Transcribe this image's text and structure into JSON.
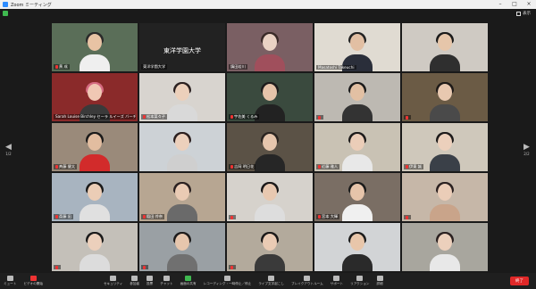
{
  "window": {
    "title": "Zoom ミーティング",
    "view_label": "表示"
  },
  "tiles": [
    {
      "name": "黄 成",
      "mic_muted": true,
      "bg": "#5a6e58",
      "skin": "#e8c3a4",
      "hair": "#2a2a2a",
      "shirt": "#efefef",
      "active": false
    },
    {
      "name": "東洋学園大学",
      "mic_muted": false,
      "bg": "#222222",
      "skin": "",
      "hair": "",
      "shirt": "",
      "active": true,
      "big_text": "東洋学園大学"
    },
    {
      "name": "鎮田若川",
      "mic_muted": false,
      "bg": "#7a5f63",
      "skin": "#ead2c4",
      "hair": "#3a2a28",
      "shirt": "#a04f5c",
      "active": false
    },
    {
      "name": "Masatoshi Takeuchi",
      "mic_muted": false,
      "bg": "#e0dbd2",
      "skin": "#e2bfa3",
      "hair": "#222222",
      "shirt": "#2a2e3a",
      "active": false
    },
    {
      "name": "",
      "mic_muted": false,
      "bg": "#cfcac3",
      "skin": "#e6c6aa",
      "hair": "#1a1a1a",
      "shirt": "#2f2f2f",
      "active": false
    },
    {
      "name": "Sarah Louise Birchley セーラ ルイーズ バーチ…",
      "mic_muted": false,
      "bg": "#8a2a2a",
      "skin": "#f0c8b4",
      "hair": "#d46a80",
      "shirt": "#3a3a3a",
      "active": false
    },
    {
      "name": "松本菜々子",
      "mic_muted": true,
      "bg": "#d8d4cf",
      "skin": "#ecd0bb",
      "hair": "#2a2020",
      "shirt": "#d9d9d9",
      "active": false
    },
    {
      "name": "宇佐美 くるみ",
      "mic_muted": true,
      "bg": "#3a4a3e",
      "skin": "#e6c4aa",
      "hair": "#1e1c1c",
      "shirt": "#222222",
      "active": false
    },
    {
      "name": "",
      "mic_muted": true,
      "bg": "#bdb9b2",
      "skin": "#e2c0a3",
      "hair": "#1a1a1a",
      "shirt": "#333333",
      "active": false
    },
    {
      "name": "",
      "mic_muted": true,
      "bg": "#6b5b45",
      "skin": "#e8c8b0",
      "hair": "#1e1a18",
      "shirt": "#4a4a4a",
      "active": false
    },
    {
      "name": "斉藤 健太",
      "mic_muted": true,
      "bg": "#9a8a7a",
      "skin": "#e2bda0",
      "hair": "#1a1a1a",
      "shirt": "#d22b2b",
      "active": false
    },
    {
      "name": "",
      "mic_muted": false,
      "bg": "#cdd2d6",
      "skin": "#ecd0bc",
      "hair": "#2a1e1e",
      "shirt": "#cfcfcf",
      "active": false
    },
    {
      "name": "吉岡 明日花",
      "mic_muted": true,
      "bg": "#5b5246",
      "skin": "#e6c6ad",
      "hair": "#2a2420",
      "shirt": "#262626",
      "active": false
    },
    {
      "name": "近藤 雅人",
      "mic_muted": true,
      "bg": "#c9c2b4",
      "skin": "#ebcdb8",
      "hair": "#1c1a1a",
      "shirt": "#e8e8e8",
      "active": false
    },
    {
      "name": "伊東 誠",
      "mic_muted": true,
      "bg": "#cfc8bb",
      "skin": "#ecd0bc",
      "hair": "#1c1a1a",
      "shirt": "#3a4048",
      "active": false
    },
    {
      "name": "斎藤 凪",
      "mic_muted": true,
      "bg": "#a8b4c0",
      "skin": "#ebcdb6",
      "hair": "#1a1a1a",
      "shirt": "#e0e0e0",
      "active": false
    },
    {
      "name": "稲田 伶奈",
      "mic_muted": true,
      "bg": "#b7a692",
      "skin": "#eacbb4",
      "hair": "#2a2020",
      "shirt": "#6a6a6a",
      "active": false
    },
    {
      "name": "",
      "mic_muted": true,
      "bg": "#d6d2cc",
      "skin": "#e8c8b0",
      "hair": "#1a1818",
      "shirt": "#dddddd",
      "active": false
    },
    {
      "name": "宮本 大輝",
      "mic_muted": true,
      "bg": "#7a6e64",
      "skin": "#e6c4aa",
      "hair": "#1a1a1a",
      "shirt": "#f0f0f0",
      "active": false
    },
    {
      "name": "",
      "mic_muted": true,
      "bg": "#c6b7a8",
      "skin": "#ebcdb8",
      "hair": "#2a2020",
      "shirt": "#c9a48a",
      "active": false
    },
    {
      "name": "",
      "mic_muted": true,
      "bg": "#c4c0b9",
      "skin": "#ecd0bc",
      "hair": "#1a1a1a",
      "shirt": "#dcdcdc",
      "active": false
    },
    {
      "name": "",
      "mic_muted": true,
      "bg": "#9aa0a4",
      "skin": "#e6c6ad",
      "hair": "#1c1a1a",
      "shirt": "#707070",
      "active": false
    },
    {
      "name": "",
      "mic_muted": true,
      "bg": "#b3aa9c",
      "skin": "#eacbb4",
      "hair": "#1a1818",
      "shirt": "#3a3a3a",
      "active": false
    },
    {
      "name": "",
      "mic_muted": false,
      "bg": "#d2d4d6",
      "skin": "#e8c6aa",
      "hair": "#1a1a1a",
      "shirt": "#2a2a2a",
      "active": false
    },
    {
      "name": "",
      "mic_muted": false,
      "bg": "#a8a69e",
      "skin": "#ecd0bc",
      "hair": "#2a2020",
      "shirt": "#e8e8e8",
      "active": false
    }
  ],
  "pager": {
    "left_count": "1/2",
    "right_count": "2/2"
  },
  "toolbar": {
    "mute": "ミュート",
    "video": "ビデオの開始",
    "security": "セキュリティ",
    "participants": "参加者",
    "polls": "投票",
    "chat": "チャット",
    "share": "画面の共有",
    "record": "レコーディング・一時停止／停止",
    "live": "ライブ文字起こし",
    "breakout": "ブレイクアウトルーム",
    "support": "サポート",
    "reactions": "リアクション",
    "details": "詳細",
    "end": "終了"
  },
  "colors": {
    "end_button": "#e02828",
    "active_outline": "#d7e04a",
    "shield": "#3fb950"
  }
}
